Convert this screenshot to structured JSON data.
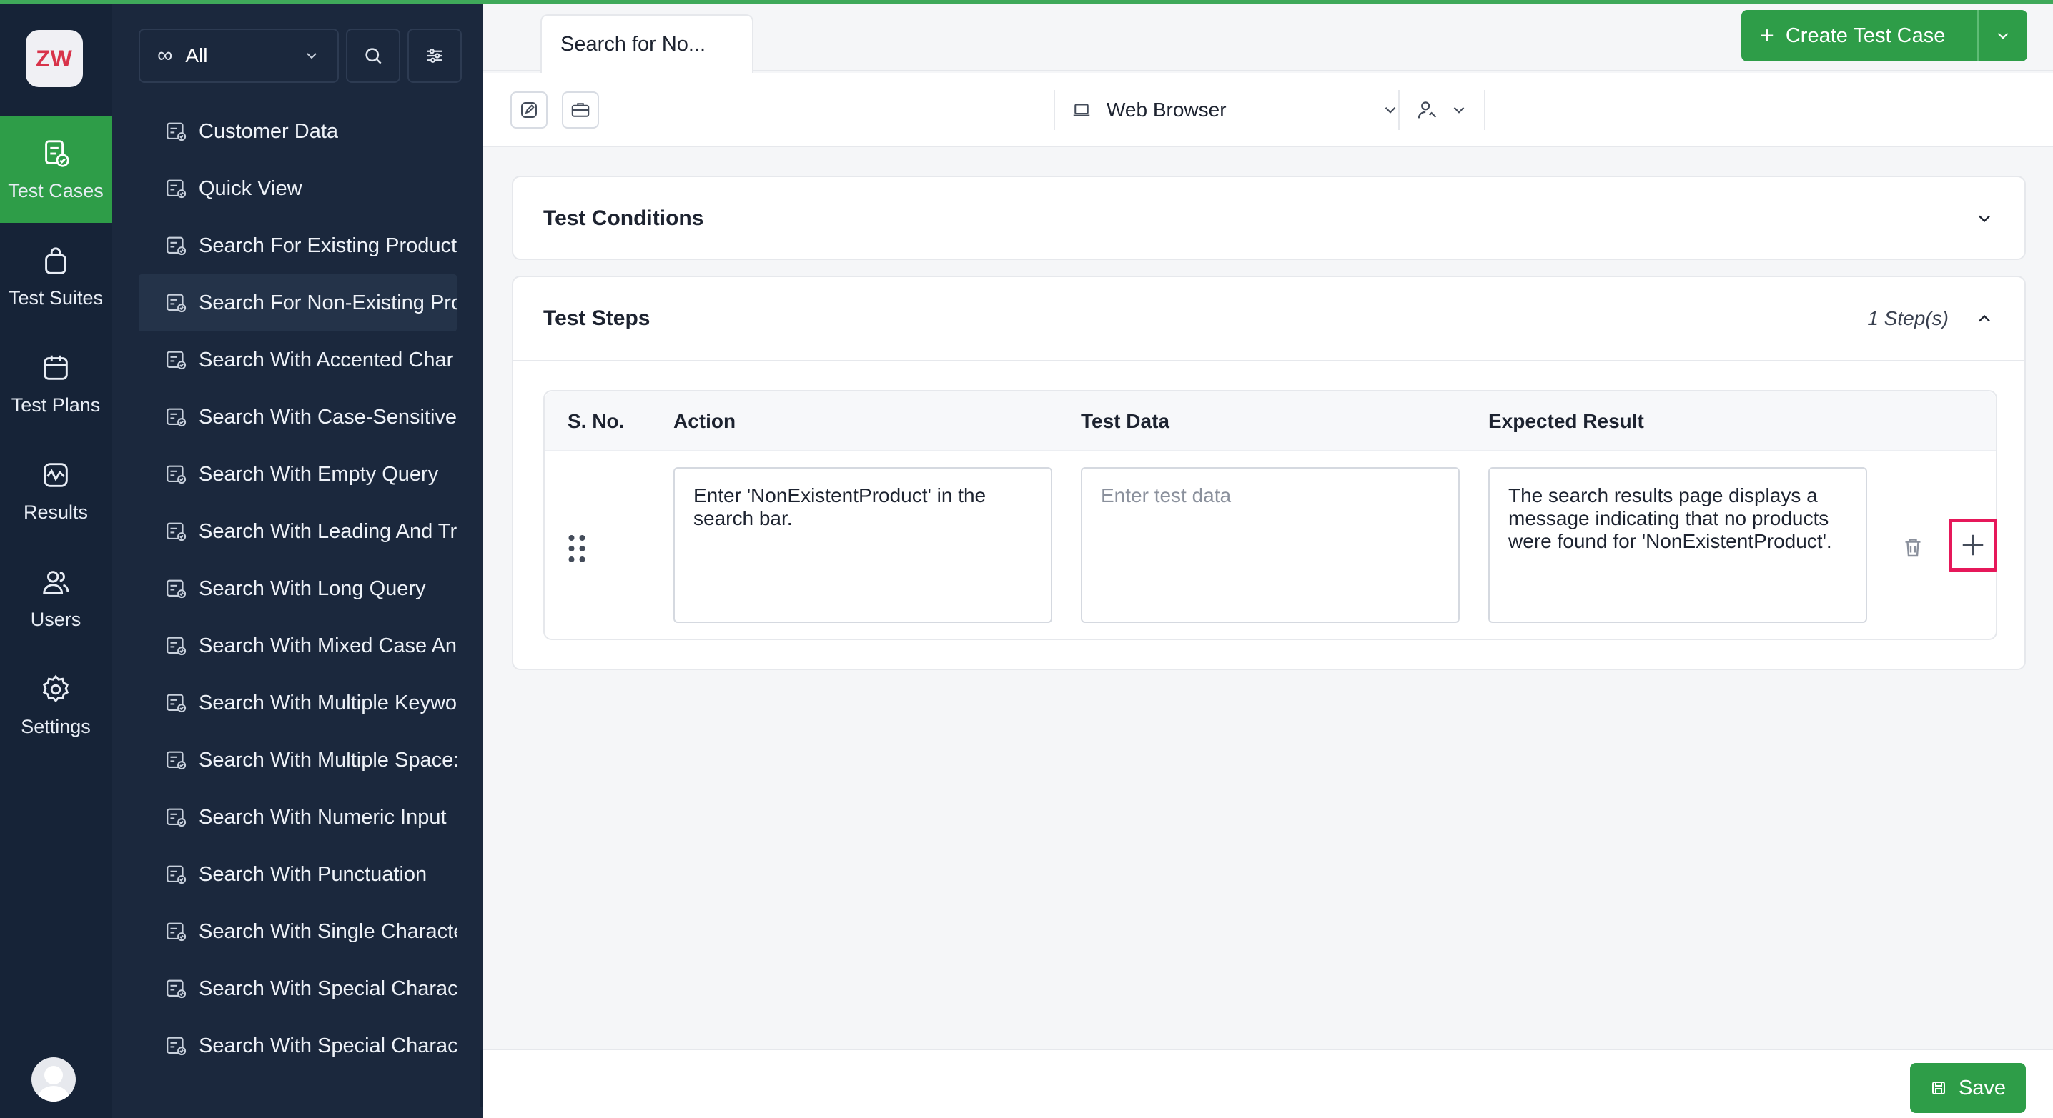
{
  "app": {
    "logo_text": "ZW",
    "accent_color": "#2e9d48",
    "highlight_color": "#e6185a"
  },
  "rail": {
    "items": [
      {
        "label": "Test Cases",
        "icon": "test-cases-icon",
        "active": true
      },
      {
        "label": "Test Suites",
        "icon": "test-suites-icon",
        "active": false
      },
      {
        "label": "Test Plans",
        "icon": "test-plans-icon",
        "active": false
      },
      {
        "label": "Results",
        "icon": "results-icon",
        "active": false
      },
      {
        "label": "Users",
        "icon": "users-icon",
        "active": false
      },
      {
        "label": "Settings",
        "icon": "settings-icon",
        "active": false
      }
    ]
  },
  "sidebar": {
    "filter_value": "All",
    "items": [
      {
        "label": "Customer Data"
      },
      {
        "label": "Quick View"
      },
      {
        "label": "Search For Existing Product"
      },
      {
        "label": "Search For Non-Existing Pro",
        "selected": true
      },
      {
        "label": "Search With Accented Char"
      },
      {
        "label": "Search With Case-Sensitive"
      },
      {
        "label": "Search With Empty Query"
      },
      {
        "label": "Search With Leading And Tr"
      },
      {
        "label": "Search With Long Query"
      },
      {
        "label": "Search With Mixed Case Anc"
      },
      {
        "label": "Search With Multiple Keywo"
      },
      {
        "label": "Search With Multiple Space:"
      },
      {
        "label": "Search With Numeric Input"
      },
      {
        "label": "Search With Punctuation"
      },
      {
        "label": "Search With Single Characte"
      },
      {
        "label": "Search With Special Charac"
      },
      {
        "label": "Search With Special Charac"
      }
    ]
  },
  "header": {
    "tab_label": "Search for No...",
    "create_label": "Create Test Case"
  },
  "toolbar": {
    "browser": "Web Browser"
  },
  "conditions": {
    "title": "Test Conditions"
  },
  "steps": {
    "title": "Test Steps",
    "count": "1 Step(s)",
    "columns": [
      "S. No.",
      "Action",
      "Test Data",
      "Expected Result"
    ],
    "rows": [
      {
        "action": "Enter 'NonExistentProduct' in the search bar.",
        "test_data_placeholder": "Enter test data",
        "expected": "The search results page displays a message indicating that no products were found for 'NonExistentProduct'."
      }
    ]
  },
  "footer": {
    "save_label": "Save"
  }
}
